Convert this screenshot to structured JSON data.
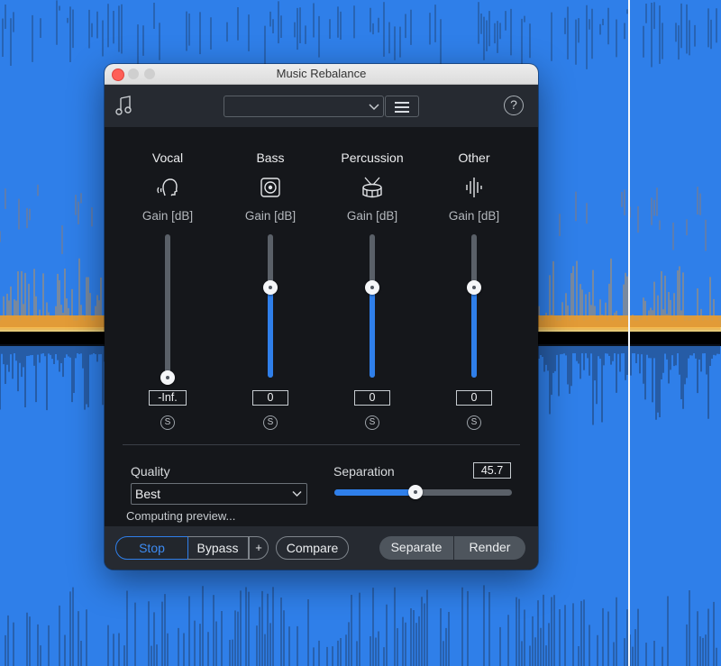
{
  "window": {
    "title": "Music Rebalance"
  },
  "toolbar": {
    "preset_value": "",
    "help_glyph": "?"
  },
  "channels": [
    {
      "name": "Vocal",
      "gain_label": "Gain [dB]",
      "value": "-Inf.",
      "solo": "S",
      "level": 0.0,
      "icon": "vocal-head-icon"
    },
    {
      "name": "Bass",
      "gain_label": "Gain [dB]",
      "value": "0",
      "solo": "S",
      "level": 0.63,
      "icon": "speaker-icon"
    },
    {
      "name": "Percussion",
      "gain_label": "Gain [dB]",
      "value": "0",
      "solo": "S",
      "level": 0.63,
      "icon": "drum-icon"
    },
    {
      "name": "Other",
      "gain_label": "Gain [dB]",
      "value": "0",
      "solo": "S",
      "level": 0.63,
      "icon": "waveform-icon"
    }
  ],
  "quality": {
    "label": "Quality",
    "selected": "Best"
  },
  "status": "Computing preview...",
  "separation": {
    "label": "Separation",
    "value": "45.7",
    "level": 0.457
  },
  "footer": {
    "stop": "Stop",
    "bypass": "Bypass",
    "plus": "+",
    "compare": "Compare",
    "separate": "Separate",
    "render": "Render"
  },
  "colors": {
    "accent": "#2f7fea",
    "background": "#2f7fe9",
    "panel": "#15171b"
  }
}
